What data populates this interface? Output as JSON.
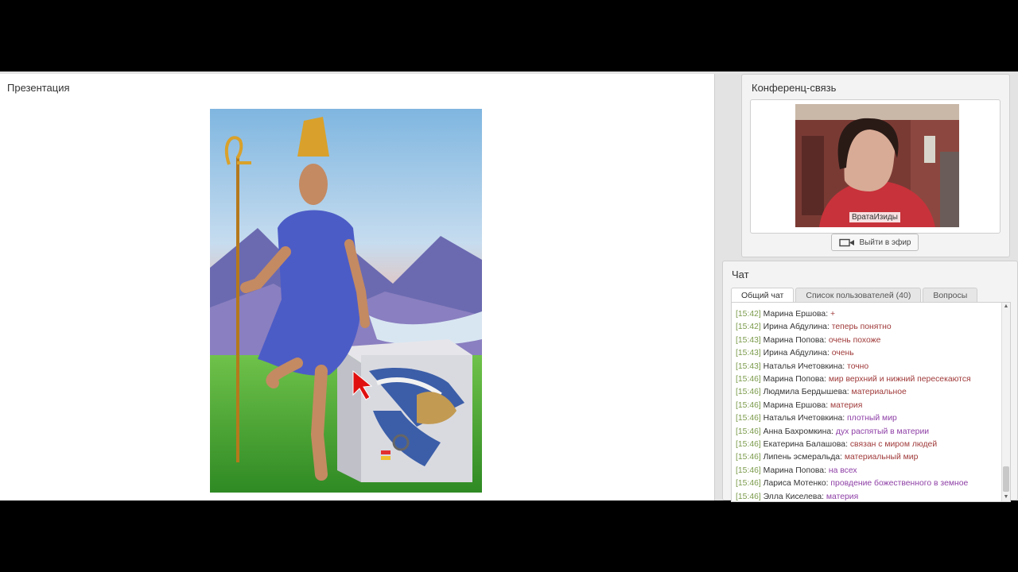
{
  "presentation": {
    "title": "Презентация"
  },
  "conference": {
    "title": "Конференц-связь",
    "presenter_name": "ВратаИзиды",
    "go_live_label": "Выйти в эфир"
  },
  "chat": {
    "title": "Чат",
    "tabs": [
      {
        "label": "Общий чат",
        "active": true
      },
      {
        "label": "Список пользователей (40)",
        "active": false
      },
      {
        "label": "Вопросы",
        "active": false
      }
    ],
    "messages": [
      {
        "time": "[15:42]",
        "author": "Марина Ершова:",
        "text": "+"
      },
      {
        "time": "[15:42]",
        "author": "Ирина Абдулина:",
        "text": "теперь понятно"
      },
      {
        "time": "[15:43]",
        "author": "Марина Попова:",
        "text": "очень похоже"
      },
      {
        "time": "[15:43]",
        "author": "Ирина Абдулина:",
        "text": "очень"
      },
      {
        "time": "[15:43]",
        "author": "Наталья Ичетовкина:",
        "text": "точно"
      },
      {
        "time": "[15:46]",
        "author": "Марина Попова:",
        "text": "мир верхний и нижний пересекаются"
      },
      {
        "time": "[15:46]",
        "author": "Людмила Бердышева:",
        "text": "материальное"
      },
      {
        "time": "[15:46]",
        "author": "Марина Ершова:",
        "text": "материя"
      },
      {
        "time": "[15:46]",
        "author": "Наталья Ичетовкина:",
        "text": "плотный мир"
      },
      {
        "time": "[15:46]",
        "author": "Анна Бахромкина:",
        "text": "дух распятый в материи"
      },
      {
        "time": "[15:46]",
        "author": "Екатерина Балашова:",
        "text": "связан с миром людей"
      },
      {
        "time": "[15:46]",
        "author": "Липень эсмеральда:",
        "text": "материальный мир"
      },
      {
        "time": "[15:46]",
        "author": "Марина Попова:",
        "text": "на всех"
      },
      {
        "time": "[15:46]",
        "author": "Лариса Мотенко:",
        "text": "провдение божественного в земное"
      },
      {
        "time": "[15:46]",
        "author": "Элла Киселева:",
        "text": "материя"
      }
    ]
  },
  "colors": {
    "timestamp": "#7a9a4a",
    "message_text": "#a03a3a",
    "message_text_alt": "#8e3fa6",
    "cursor": "#e01010"
  }
}
